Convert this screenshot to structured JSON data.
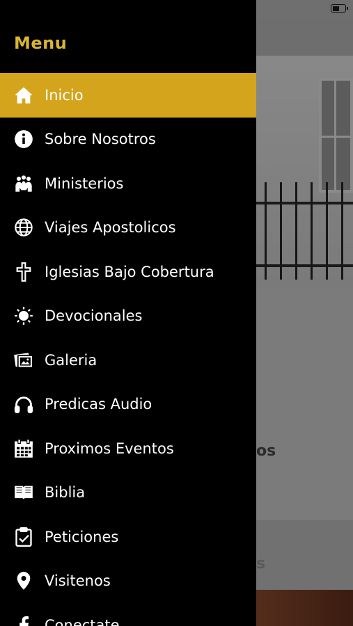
{
  "background": {
    "heading_fragment": "os",
    "band_fragment": "s"
  },
  "drawer": {
    "title": "Menu",
    "accent_color": "#d4a51c",
    "items": [
      {
        "label": "Inicio",
        "icon": "home-icon",
        "active": true
      },
      {
        "label": "Sobre Nosotros",
        "icon": "info-icon"
      },
      {
        "label": "Ministerios",
        "icon": "people-icon"
      },
      {
        "label": "Viajes Apostolicos",
        "icon": "globe-icon"
      },
      {
        "label": "Iglesias Bajo Cobertura",
        "icon": "cross-icon"
      },
      {
        "label": "Devocionales",
        "icon": "sun-icon"
      },
      {
        "label": "Galeria",
        "icon": "gallery-icon"
      },
      {
        "label": "Predicas Audio",
        "icon": "headphones-icon"
      },
      {
        "label": "Proximos Eventos",
        "icon": "calendar-icon"
      },
      {
        "label": "Biblia",
        "icon": "book-icon"
      },
      {
        "label": "Peticiones",
        "icon": "clipboard-icon"
      },
      {
        "label": "Visitenos",
        "icon": "location-pin-icon"
      },
      {
        "label": "Conectate",
        "icon": "facebook-icon"
      }
    ]
  }
}
